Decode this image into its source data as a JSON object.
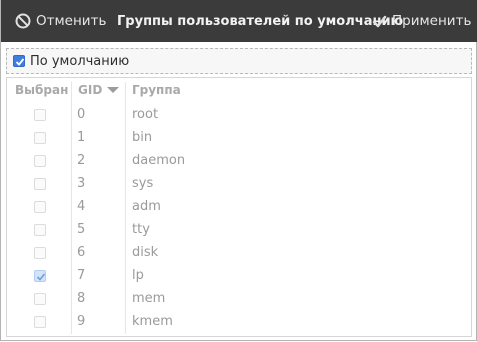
{
  "header": {
    "cancel_label": "Отменить",
    "title": "Группы пользователей по умолчанию",
    "apply_label": "Применить"
  },
  "default_option": {
    "label": "По умолчанию",
    "checked": true
  },
  "table": {
    "columns": {
      "selected": "Выбран",
      "gid": "GID",
      "group": "Группа"
    },
    "sort": {
      "column": "gid",
      "direction": "descending-arrow"
    },
    "rows": [
      {
        "selected": false,
        "gid": "0",
        "group": "root"
      },
      {
        "selected": false,
        "gid": "1",
        "group": "bin"
      },
      {
        "selected": false,
        "gid": "2",
        "group": "daemon"
      },
      {
        "selected": false,
        "gid": "3",
        "group": "sys"
      },
      {
        "selected": false,
        "gid": "4",
        "group": "adm"
      },
      {
        "selected": false,
        "gid": "5",
        "group": "tty"
      },
      {
        "selected": false,
        "gid": "6",
        "group": "disk"
      },
      {
        "selected": true,
        "gid": "7",
        "group": "lp"
      },
      {
        "selected": false,
        "gid": "8",
        "group": "mem"
      },
      {
        "selected": false,
        "gid": "9",
        "group": "kmem"
      }
    ]
  },
  "colors": {
    "headerbar": "#3b3b3b",
    "accent": "#3d7ee0",
    "checked_row_box": "#d3e3f8"
  }
}
